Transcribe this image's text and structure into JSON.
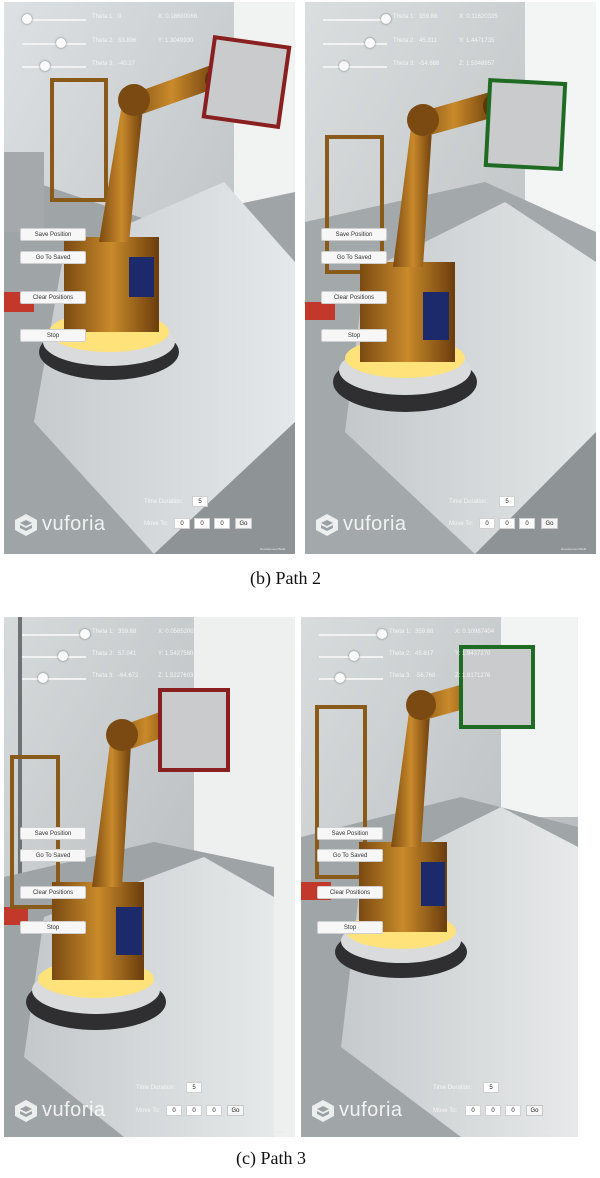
{
  "panels": [
    {
      "sliders": [
        {
          "label": "Theta 1:",
          "value": "0",
          "coord": "X: 0.18680066"
        },
        {
          "label": "Theta 2:",
          "value": "53.896",
          "coord": "Y: 1.3049930"
        },
        {
          "label": "Theta 3:",
          "value": "-40.27",
          "coord": ""
        }
      ],
      "target_frame_color": "#8a1f1f",
      "buttons": {
        "save": "Save Position",
        "go_saved": "Go To Saved",
        "clear": "Clear Positions",
        "stop": "Stop"
      },
      "time_duration": {
        "label": "Time Duration:",
        "value": "5"
      },
      "move_to": {
        "label": "Move To:",
        "values": [
          "0",
          "0",
          "0"
        ],
        "go": "Go"
      },
      "logo": "vuforia",
      "dev_build": "Development Build"
    },
    {
      "sliders": [
        {
          "label": "Theta 1:",
          "value": "359.88",
          "coord": "X: 0.11620335"
        },
        {
          "label": "Theta 2:",
          "value": "45.311",
          "coord": "Y: 1.4471735"
        },
        {
          "label": "Theta 3:",
          "value": "-54.688",
          "coord": "Z: 1.5948857"
        }
      ],
      "target_frame_color": "#1f6b24",
      "buttons": {
        "save": "Save Position",
        "go_saved": "Go To Saved",
        "clear": "Clear Positions",
        "stop": "Stop"
      },
      "time_duration": {
        "label": "Time Duration:",
        "value": "5"
      },
      "move_to": {
        "label": "Move To:",
        "values": [
          "0",
          "0",
          "0"
        ],
        "go": "Go"
      },
      "logo": "vuforia",
      "dev_build": "Development Build"
    },
    {
      "sliders": [
        {
          "label": "Theta 1:",
          "value": "359.88",
          "coord": "X: 0.05652007"
        },
        {
          "label": "Theta 2:",
          "value": "57.041",
          "coord": "Y: 1.5427560"
        },
        {
          "label": "Theta 3:",
          "value": "-64.672",
          "coord": "Z: 1.5227603"
        }
      ],
      "target_frame_color": "#8a1f1f",
      "buttons": {
        "save": "Save Position",
        "go_saved": "Go To Saved",
        "clear": "Clear Positions",
        "stop": "Stop"
      },
      "time_duration": {
        "label": "Time Duration:",
        "value": "5"
      },
      "move_to": {
        "label": "Move To:",
        "values": [
          "0",
          "0",
          "0"
        ],
        "go": "Go"
      },
      "logo": "vuforia",
      "dev_build": "Development Build"
    },
    {
      "sliders": [
        {
          "label": "Theta 1:",
          "value": "359.88",
          "coord": "X: 0.10987404"
        },
        {
          "label": "Theta 2:",
          "value": "45.817",
          "coord": "Y: 1.9437270"
        },
        {
          "label": "Theta 3:",
          "value": "-56.768",
          "coord": "Z: 1.8171276"
        }
      ],
      "target_frame_color": "#1f6b24",
      "buttons": {
        "save": "Save Position",
        "go_saved": "Go To Saved",
        "clear": "Clear Positions",
        "stop": "Stop"
      },
      "time_duration": {
        "label": "Time Duration:",
        "value": "5"
      },
      "move_to": {
        "label": "Move To:",
        "values": [
          "0",
          "0",
          "0"
        ],
        "go": "Go"
      },
      "logo": "vuforia",
      "dev_build": "Development Build"
    }
  ],
  "captions": {
    "path2": "(b) Path 2",
    "path3": "(c)  Path 3"
  }
}
